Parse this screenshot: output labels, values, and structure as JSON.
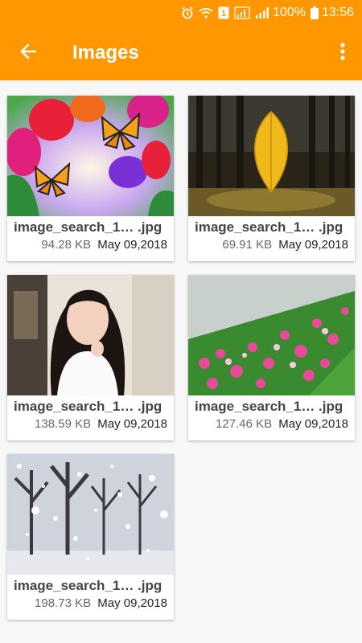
{
  "status_bar": {
    "battery_percent": "100%",
    "time": "13:56",
    "sim_badge": "1"
  },
  "app_bar": {
    "title": "Images",
    "back_icon": "arrow-left-icon",
    "menu_icon": "more-vert-icon"
  },
  "colors": {
    "accent": "#ff9800",
    "background": "#f7f7f7"
  },
  "images": [
    {
      "name": "image_search_1… .jpg",
      "size": "94.28 KB",
      "date": "May 09,2018",
      "thumbnail": "tulips-butterflies"
    },
    {
      "name": "image_search_1… .jpg",
      "size": "69.91 KB",
      "date": "May 09,2018",
      "thumbnail": "yellow-leaf-forest"
    },
    {
      "name": "image_search_1… .jpg",
      "size": "138.59 KB",
      "date": "May 09,2018",
      "thumbnail": "woman-portrait"
    },
    {
      "name": "image_search_1… .jpg",
      "size": "127.46 KB",
      "date": "May 09,2018",
      "thumbnail": "pink-flower-path"
    },
    {
      "name": "image_search_1… .jpg",
      "size": "198.73 KB",
      "date": "May 09,2018",
      "thumbnail": "snowy-forest"
    }
  ]
}
